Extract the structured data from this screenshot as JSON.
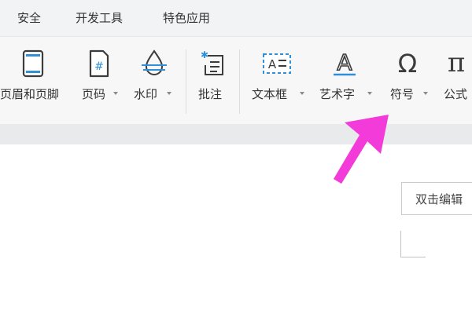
{
  "menu": {
    "tabs": [
      {
        "label": "安全"
      },
      {
        "label": "开发工具"
      },
      {
        "label": "特色应用"
      }
    ]
  },
  "ribbon": {
    "header_footer_label": "页眉和页脚",
    "page_number_label": "页码",
    "watermark_label": "水印",
    "comment_label": "批注",
    "textbox_label": "文本框",
    "wordart_label": "艺术字",
    "symbol_label": "符号",
    "formula_label": "公式",
    "symbol_glyph": "Ω",
    "formula_glyph": "π",
    "wordart_glyph": "A",
    "page_number_glyph": "#",
    "textbox_glyph": "A"
  },
  "document": {
    "hint_text": "双击编辑"
  },
  "colors": {
    "accent": "#f23bd8",
    "icon_blue": "#2f8fd8",
    "icon_dark": "#3c3c3c"
  },
  "icons": [
    "header-footer-icon",
    "page-number-icon",
    "watermark-icon",
    "comment-icon",
    "textbox-icon",
    "wordart-icon",
    "symbol-icon",
    "formula-icon",
    "pointer-arrow-icon"
  ]
}
